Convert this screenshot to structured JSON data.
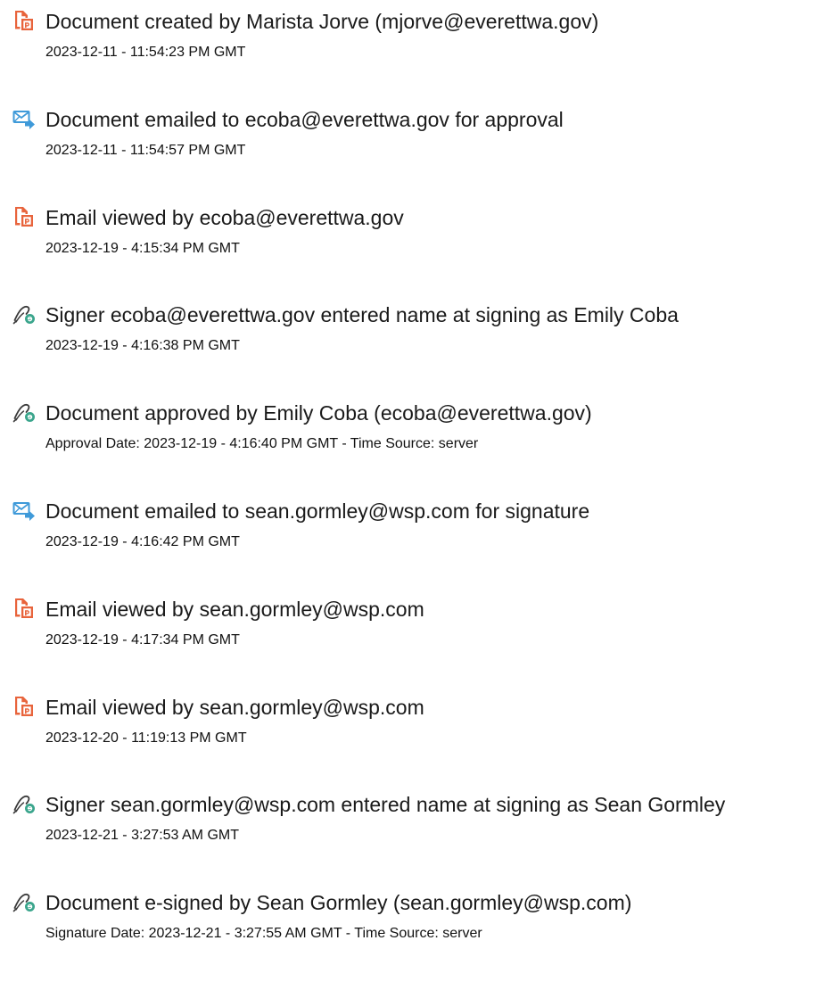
{
  "colors": {
    "document_icon": "#e8643c",
    "email_icon": "#3f9ad9",
    "sign_icon": "#3aa58c",
    "text": "#1a1a1a"
  },
  "events": [
    {
      "icon": "document-icon",
      "title": "Document created by Marista Jorve (mjorve@everettwa.gov)",
      "detail": "2023-12-11 - 11:54:23 PM GMT"
    },
    {
      "icon": "email-icon",
      "title": "Document emailed to ecoba@everettwa.gov for approval",
      "detail": "2023-12-11 - 11:54:57 PM GMT"
    },
    {
      "icon": "document-icon",
      "title": "Email viewed by ecoba@everettwa.gov",
      "detail": "2023-12-19 - 4:15:34 PM GMT"
    },
    {
      "icon": "sign-icon",
      "title": "Signer ecoba@everettwa.gov entered name at signing as Emily Coba",
      "detail": "2023-12-19 - 4:16:38 PM GMT"
    },
    {
      "icon": "sign-icon",
      "title": "Document approved by Emily Coba (ecoba@everettwa.gov)",
      "detail": "Approval Date: 2023-12-19 - 4:16:40 PM GMT - Time Source: server"
    },
    {
      "icon": "email-icon",
      "title": "Document emailed to sean.gormley@wsp.com for signature",
      "detail": "2023-12-19 - 4:16:42 PM GMT"
    },
    {
      "icon": "document-icon",
      "title": "Email viewed by sean.gormley@wsp.com",
      "detail": "2023-12-19 - 4:17:34 PM GMT"
    },
    {
      "icon": "document-icon",
      "title": "Email viewed by sean.gormley@wsp.com",
      "detail": "2023-12-20 - 11:19:13 PM GMT"
    },
    {
      "icon": "sign-icon",
      "title": "Signer sean.gormley@wsp.com entered name at signing as Sean Gormley",
      "detail": "2023-12-21 - 3:27:53 AM GMT"
    },
    {
      "icon": "sign-icon",
      "title": "Document e-signed by Sean Gormley (sean.gormley@wsp.com)",
      "detail": "Signature Date: 2023-12-21 - 3:27:55 AM GMT - Time Source: server"
    }
  ]
}
